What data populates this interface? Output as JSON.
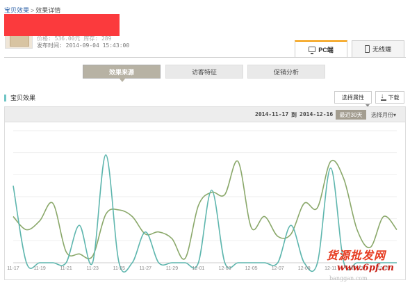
{
  "breadcrumb": {
    "root": "宝贝效果",
    "sep": ">",
    "current": "效果详情"
  },
  "item": {
    "price_line": "价格: 536.00元    库存: 289",
    "publish_line": "发布时间: 2014-09-04 15:43:00"
  },
  "device_tabs": {
    "pc": "PC端",
    "mobile": "无线端",
    "active": "pc"
  },
  "sub_tabs": [
    {
      "label": "效果来源"
    },
    {
      "label": "访客特征"
    },
    {
      "label": "促销分析"
    }
  ],
  "section": {
    "title": "宝贝效果",
    "select_attr": "选择属性",
    "download": "下载"
  },
  "range": {
    "start": "2014-11-17",
    "to": "到",
    "end": "2014-12-16",
    "recent": "最近30天",
    "month": "选择月份"
  },
  "watermark": {
    "line1": "货源批发网",
    "line2": "www.6pf.cn",
    "line3": "banggan.com"
  },
  "colors": {
    "series_a": "#5eb6ae",
    "series_b": "#8aa86a",
    "accent_tab": "#f39800"
  },
  "chart_data": {
    "type": "line",
    "x": [
      "11-17",
      "11-18",
      "11-19",
      "11-20",
      "11-21",
      "11-22",
      "11-23",
      "11-24",
      "11-25",
      "11-26",
      "11-27",
      "11-28",
      "11-29",
      "11-30",
      "12-01",
      "12-02",
      "12-03",
      "12-04",
      "12-05",
      "12-06",
      "12-07",
      "12-08",
      "12-09",
      "12-10",
      "12-11",
      "12-12",
      "12-13",
      "12-14",
      "12-15",
      "12-16"
    ],
    "x_tick_labels": [
      "11-17",
      "11-19",
      "11-21",
      "11-23",
      "11-25",
      "11-27",
      "11-29",
      "12-01",
      "12-03",
      "12-05",
      "12-07",
      "12-09",
      "12-11",
      "12-13",
      "12-15"
    ],
    "ylim": [
      0,
      6
    ],
    "grid": true,
    "series": [
      {
        "values": [
          3.5,
          0,
          0,
          0,
          0,
          1.7,
          0,
          4.9,
          0,
          0,
          1.4,
          0,
          0,
          0,
          0,
          3.3,
          0,
          0,
          0,
          0,
          0,
          1.7,
          0,
          0,
          4.3,
          0,
          0,
          0,
          0,
          0
        ]
      },
      {
        "values": [
          2.1,
          1.5,
          1.9,
          2.7,
          0.5,
          0.4,
          0.3,
          2.2,
          2.4,
          2.1,
          1.3,
          1.4,
          1.1,
          0.2,
          2.6,
          3.2,
          3.1,
          4.6,
          1.6,
          2.1,
          1.2,
          1.3,
          2.7,
          2.5,
          4.6,
          3.8,
          1.5,
          0.7,
          2.1,
          1.5
        ]
      }
    ]
  }
}
